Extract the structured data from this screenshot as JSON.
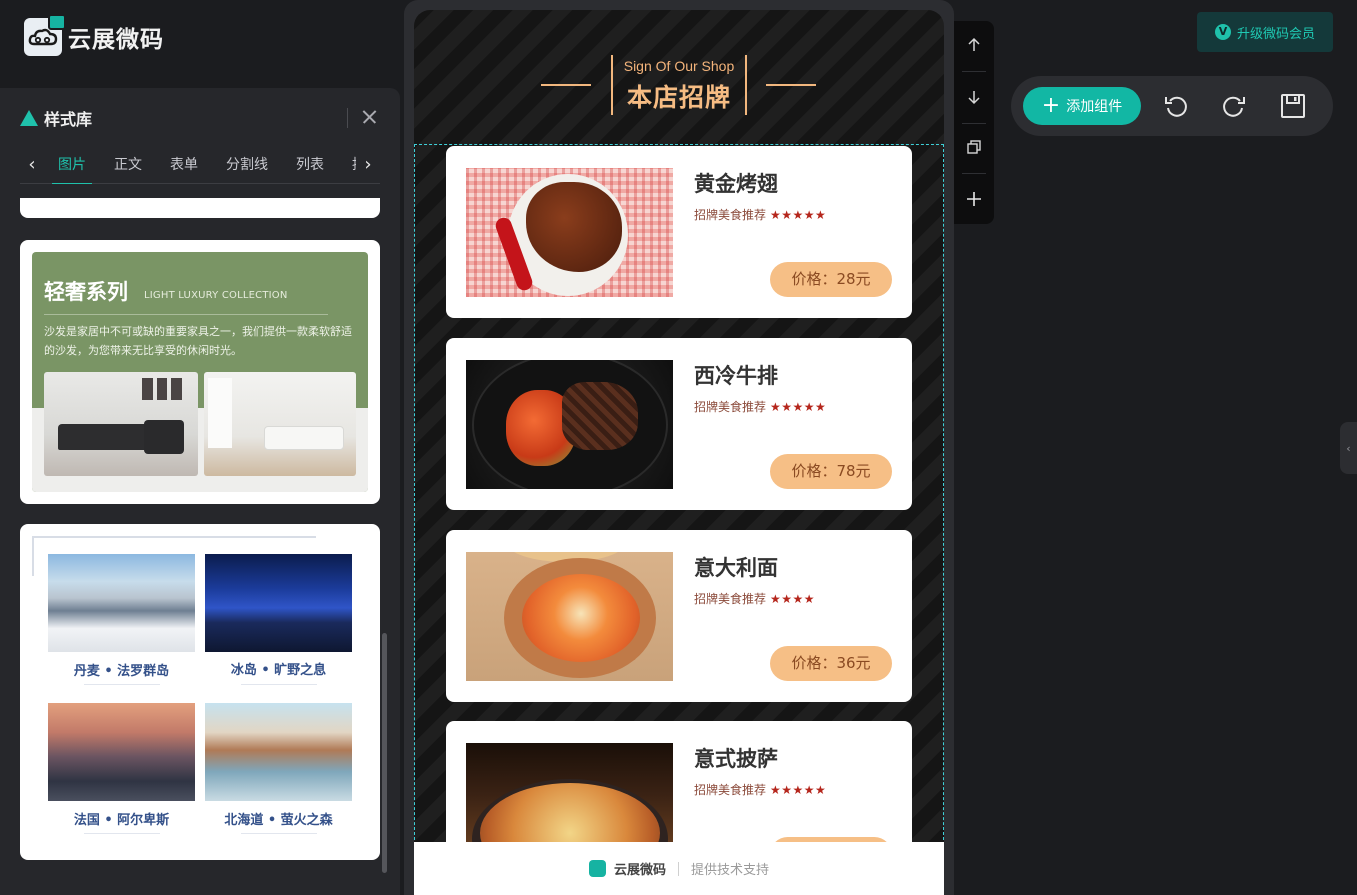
{
  "app": {
    "brand": "云展微码",
    "upgrade_label": "升级微码会员",
    "add_component_label": "添加组件"
  },
  "style_library": {
    "title": "样式库",
    "tabs": [
      "图片",
      "正文",
      "表单",
      "分割线",
      "列表",
      "按"
    ],
    "active_tab": "图片",
    "luxury_card": {
      "title": "轻奢系列",
      "subtitle": "LIGHT LUXURY COLLECTION",
      "description": "沙发是家居中不可或缺的重要家具之一，我们提供一款柔软舒适的沙发，为您带来无比享受的休闲时光。"
    },
    "photo_card": {
      "captions": [
        "丹麦 • 法罗群岛",
        "冰岛 • 旷野之息",
        "法国 • 阿尔卑斯",
        "北海道 • 萤火之森"
      ]
    }
  },
  "preview": {
    "sign_en": "Sign Of Our Shop",
    "sign_cn": "本店招牌",
    "items": [
      {
        "name": "黄金烤翅",
        "tag": "招牌美食推荐",
        "stars": "★★★★★",
        "price": "价格：28元"
      },
      {
        "name": "西冷牛排",
        "tag": "招牌美食推荐",
        "stars": "★★★★★",
        "price": "价格：78元"
      },
      {
        "name": "意大利面",
        "tag": "招牌美食推荐",
        "stars": "★★★★",
        "price": "价格：36元"
      },
      {
        "name": "意式披萨",
        "tag": "招牌美食推荐",
        "stars": "★★★★★",
        "price": ""
      }
    ],
    "footer_brand": "云展微码",
    "footer_support": "提供技术支持"
  },
  "icons": {
    "close": "close-icon",
    "prev": "chevron-left-icon",
    "next": "chevron-right-icon",
    "move_up": "arrow-up-icon",
    "move_down": "arrow-down-icon",
    "duplicate": "copy-icon",
    "add": "plus-icon",
    "undo": "undo-icon",
    "redo": "redo-icon",
    "save": "save-icon"
  },
  "colors": {
    "accent": "#1fc1ab",
    "price_bg": "#f6bf86",
    "sign_gold": "#f2b77e",
    "star_red": "#b5261c"
  }
}
